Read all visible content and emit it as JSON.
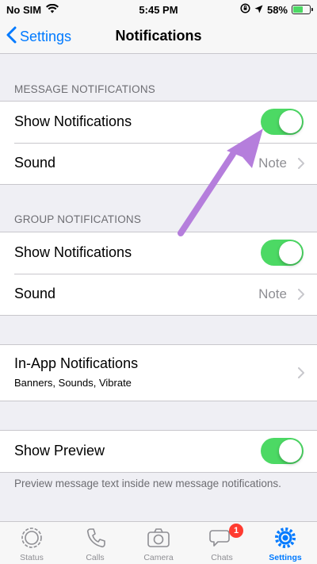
{
  "status": {
    "carrier": "No SIM",
    "time": "5:45 PM",
    "battery": "58%"
  },
  "nav": {
    "back_label": "Settings",
    "title": "Notifications"
  },
  "message_notifications": {
    "header": "MESSAGE NOTIFICATIONS",
    "show_label": "Show Notifications",
    "show_enabled": true,
    "sound_label": "Sound",
    "sound_value": "Note"
  },
  "group_notifications": {
    "header": "GROUP NOTIFICATIONS",
    "show_label": "Show Notifications",
    "show_enabled": true,
    "sound_label": "Sound",
    "sound_value": "Note"
  },
  "in_app": {
    "title": "In-App Notifications",
    "subtitle": "Banners, Sounds, Vibrate"
  },
  "preview": {
    "label": "Show Preview",
    "enabled": true,
    "note": "Preview message text inside new message notifications."
  },
  "tabs": [
    {
      "label": "Status",
      "icon": "status-icon"
    },
    {
      "label": "Calls",
      "icon": "phone-icon"
    },
    {
      "label": "Camera",
      "icon": "camera-icon"
    },
    {
      "label": "Chats",
      "icon": "chat-bubbles-icon",
      "badge": "1"
    },
    {
      "label": "Settings",
      "icon": "gear-icon",
      "active": true
    }
  ],
  "colors": {
    "accent": "#007aff",
    "toggle_on": "#4cd964",
    "badge": "#ff3b30",
    "annotation_arrow": "#b57edc"
  }
}
